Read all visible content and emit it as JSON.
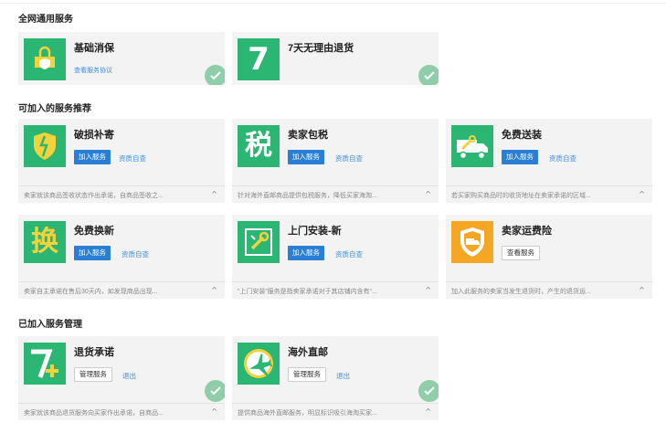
{
  "sections": {
    "general": "全网通用服务",
    "recommended": "可加入的服务推荐",
    "joined": "已加入服务管理"
  },
  "general_cards": [
    {
      "title": "基础消保",
      "link": "查看服务协议"
    },
    {
      "title": "7天无理由退货"
    }
  ],
  "recommended_cards": [
    {
      "title": "破损补寄",
      "button": "加入服务",
      "link": "资质自查",
      "desc": "卖家就该商品签收状态作出承诺，自商品签收之..."
    },
    {
      "title": "卖家包税",
      "button": "加入服务",
      "link": "资质自查",
      "desc": "针对海外直邮商品提供包税服务，降低买家海淘..."
    },
    {
      "title": "免费送装",
      "button": "加入服务",
      "link": "资质自查",
      "desc": "若买家购买商品时的收货地址在卖家承诺的区域..."
    },
    {
      "title": "免费换新",
      "button": "加入服务",
      "link": "资质自查",
      "desc": "卖家自主承诺在售后30天内，如发现商品出现..."
    },
    {
      "title": "上门安装-新",
      "button": "加入服务",
      "link": "资质自查",
      "desc": "“上门安装”服务是指卖家承诺对于其店铺内含有“..."
    },
    {
      "title": "卖家运费险",
      "button": "查看服务",
      "desc": "加入此服务的卖家当发生退货时，产生的退货运..."
    }
  ],
  "joined_cards": [
    {
      "title": "退货承诺",
      "button": "管理服务",
      "link": "退出",
      "desc": "卖家就该商品退货服务向买家作出承诺，自商品..."
    },
    {
      "title": "海外直邮",
      "button": "管理服务",
      "link": "退出",
      "desc": "提供商品海外直邮服务，明显标识吸引海淘买家..."
    }
  ],
  "icons": {
    "jichuxiaobao": "shield-bag-icon",
    "seven_day": "seven-icon",
    "posun": "broken-shield-icon",
    "baoshui": "tax-icon",
    "songzhuang": "delivery-truck-icon",
    "huanxin": "exchange-icon",
    "anzhuang": "installation-icon",
    "yunfei": "freight-insurance-icon",
    "tuihuo": "seven-plus-icon",
    "zhiyou": "airplane-icon"
  },
  "glyphs": {
    "tax": "税",
    "exchange": "换",
    "seven": "7"
  },
  "colors": {
    "icon_green": "#2bb673",
    "icon_orange": "#f5a623",
    "accent_blue": "#2a7fd4",
    "link_blue": "#3a8ee6",
    "check_green": "#8fcea9"
  }
}
